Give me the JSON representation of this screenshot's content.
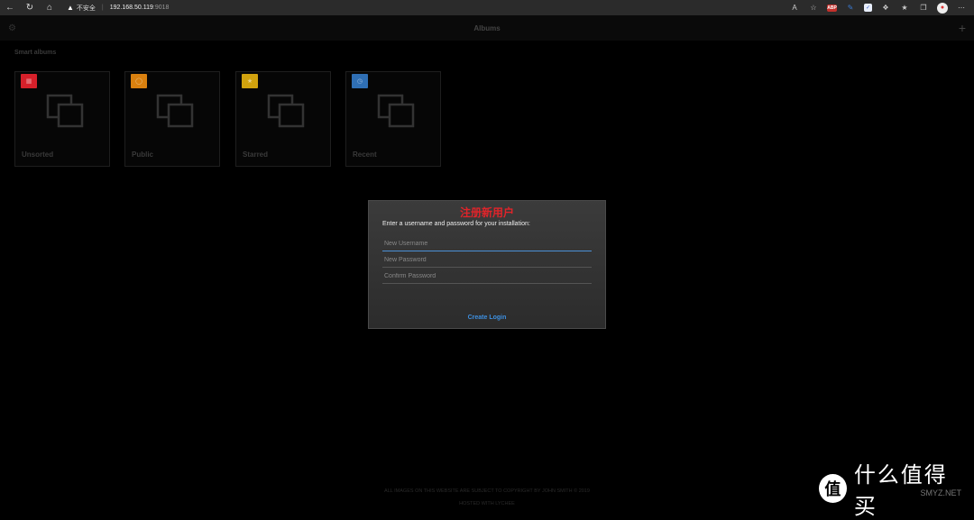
{
  "browser": {
    "security_label": "不安全",
    "url_host": "192.168.50.119",
    "url_port": ":9018",
    "abp_label": "ABP"
  },
  "app": {
    "title": "Albums",
    "section_title": "Smart albums"
  },
  "albums": [
    {
      "label": "Unsorted",
      "color": "#d6202a"
    },
    {
      "label": "Public",
      "color": "#d9800f"
    },
    {
      "label": "Starred",
      "color": "#d1a20e"
    },
    {
      "label": "Recent",
      "color": "#2f6fb4"
    }
  ],
  "dialog": {
    "title": "注册新用户",
    "instruction": "Enter a username and password for your installation:",
    "username_placeholder": "New Username",
    "password_placeholder": "New Password",
    "confirm_placeholder": "Confirm Password",
    "create_label": "Create Login"
  },
  "footer": {
    "copyright": "ALL IMAGES ON THIS WEBSITE ARE SUBJECT TO COPYRIGHT BY JOHN SMITH © 2019",
    "hosted": "HOSTED WITH LYCHEE"
  },
  "watermark": {
    "logo": "值",
    "text": "什么值得买",
    "sub": "SMYZ.NET"
  }
}
